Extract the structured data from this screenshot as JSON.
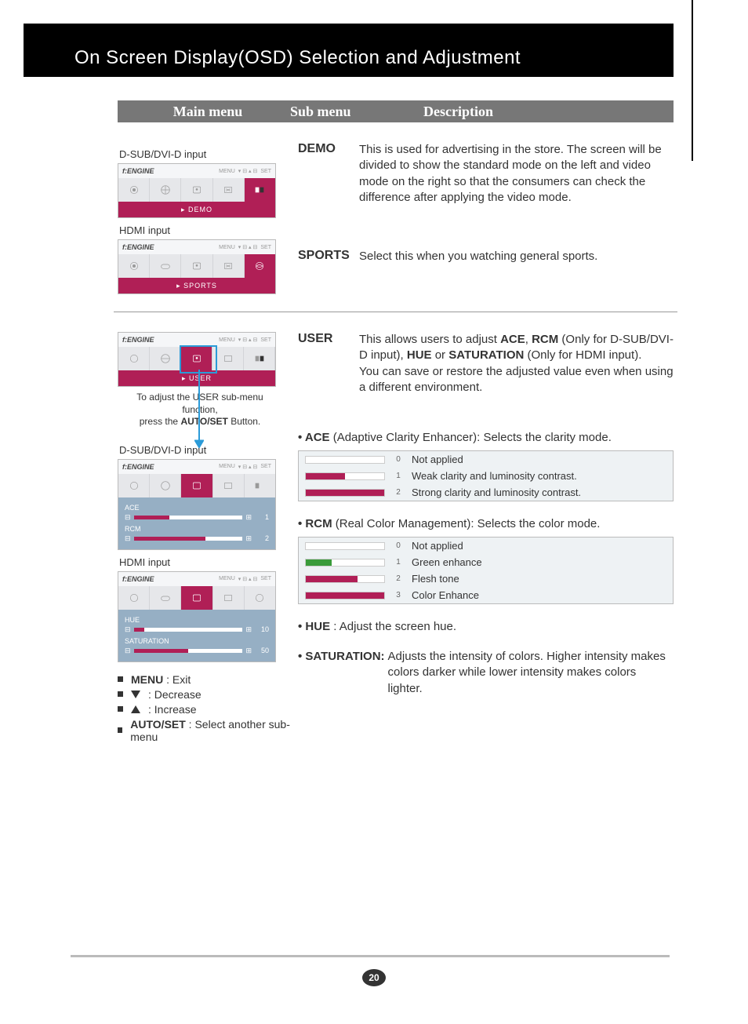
{
  "title": "On Screen Display(OSD) Selection and Adjustment",
  "headers": {
    "main": "Main menu",
    "sub": "Sub menu",
    "desc": "Description"
  },
  "labels": {
    "dsub": "D-SUB/DVI-D input",
    "hdmi": "HDMI input"
  },
  "osd": {
    "brand": "f:ENGINE",
    "menu": "MENU",
    "set": "SET",
    "demo_foot": "▸ DEMO",
    "sports_foot": "▸ SPORTS",
    "user_foot": "▸ USER",
    "ace_label": "ACE",
    "rcm_label": "RCM",
    "hue_label": "HUE",
    "sat_label": "SATURATION",
    "ace_val": "1",
    "rcm_val": "2",
    "hue_val": "10",
    "sat_val": "50"
  },
  "adjust_note_1": "To adjust the USER sub-menu function,",
  "adjust_note_2_pre": "press the ",
  "adjust_note_2_b": "AUTO/SET",
  "adjust_note_2_post": " Button.",
  "demo": {
    "name": "DEMO",
    "desc": "This is used for advertising in the store. The screen will be divided to show the standard mode on the left and video mode on the right so that the consumers can check the difference after applying the video mode."
  },
  "sports": {
    "name": "SPORTS",
    "desc": "Select this when you watching general sports."
  },
  "user": {
    "name": "USER",
    "desc_1": "This allows users to adjust ",
    "desc_ace": "ACE",
    "desc_2": ", ",
    "desc_rcm": "RCM",
    "desc_3": " (Only for D-SUB/DVI-D input), ",
    "desc_hue": "HUE",
    "desc_4": " or ",
    "desc_sat": "SATURATION",
    "desc_5": " (Only for HDMI input).",
    "desc_6": "You can save or restore the adjusted value even when using a different environment."
  },
  "ace": {
    "title_b": "• ACE",
    "title_rest": " (Adaptive Clarity Enhancer): Selects the clarity mode.",
    "r0": "Not applied",
    "r1": "Weak clarity and luminosity contrast.",
    "r2": "Strong clarity and luminosity contrast.",
    "n0": "0",
    "n1": "1",
    "n2": "2"
  },
  "rcm": {
    "title_b": "• RCM",
    "title_rest": " (Real Color Management): Selects the color mode.",
    "r0": "Not applied",
    "r1": "Green enhance",
    "r2": "Flesh tone",
    "r3": "Color Enhance",
    "n0": "0",
    "n1": "1",
    "n2": "2",
    "n3": "3"
  },
  "hue": {
    "title_b": "• HUE",
    "title_rest": " : Adjust the screen hue."
  },
  "sat": {
    "title_b": "• SATURATION:",
    "desc": "Adjusts the intensity of colors. Higher intensity makes colors darker while lower intensity makes colors lighter."
  },
  "bullets": {
    "menu_b": "MENU",
    "menu_t": " : Exit",
    "dec": "    : Decrease",
    "inc": "    : Increase",
    "auto_b": "AUTO/SET",
    "auto_t": " : Select another sub-menu"
  },
  "page_no": "20"
}
